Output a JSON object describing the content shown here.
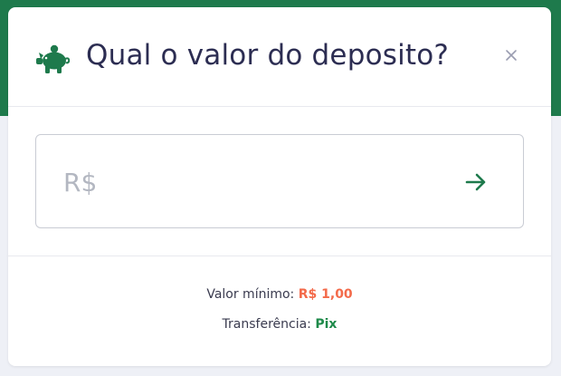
{
  "colors": {
    "brand_green": "#1e7a4c",
    "title_text": "#2c2d52",
    "min_value": "#f36a4a",
    "transfer_value": "#1e8a4a",
    "placeholder": "#b3b7c1"
  },
  "modal": {
    "title": "Qual o valor do deposito?",
    "title_icon": "piggy-bank-icon",
    "close_label": "×"
  },
  "amount": {
    "placeholder": "R$",
    "value": "",
    "submit_icon": "arrow-right-icon"
  },
  "info": {
    "min_label": "Valor mínimo:",
    "min_value": "R$ 1,00",
    "transfer_label": "Transferência:",
    "transfer_value": "Pix"
  }
}
